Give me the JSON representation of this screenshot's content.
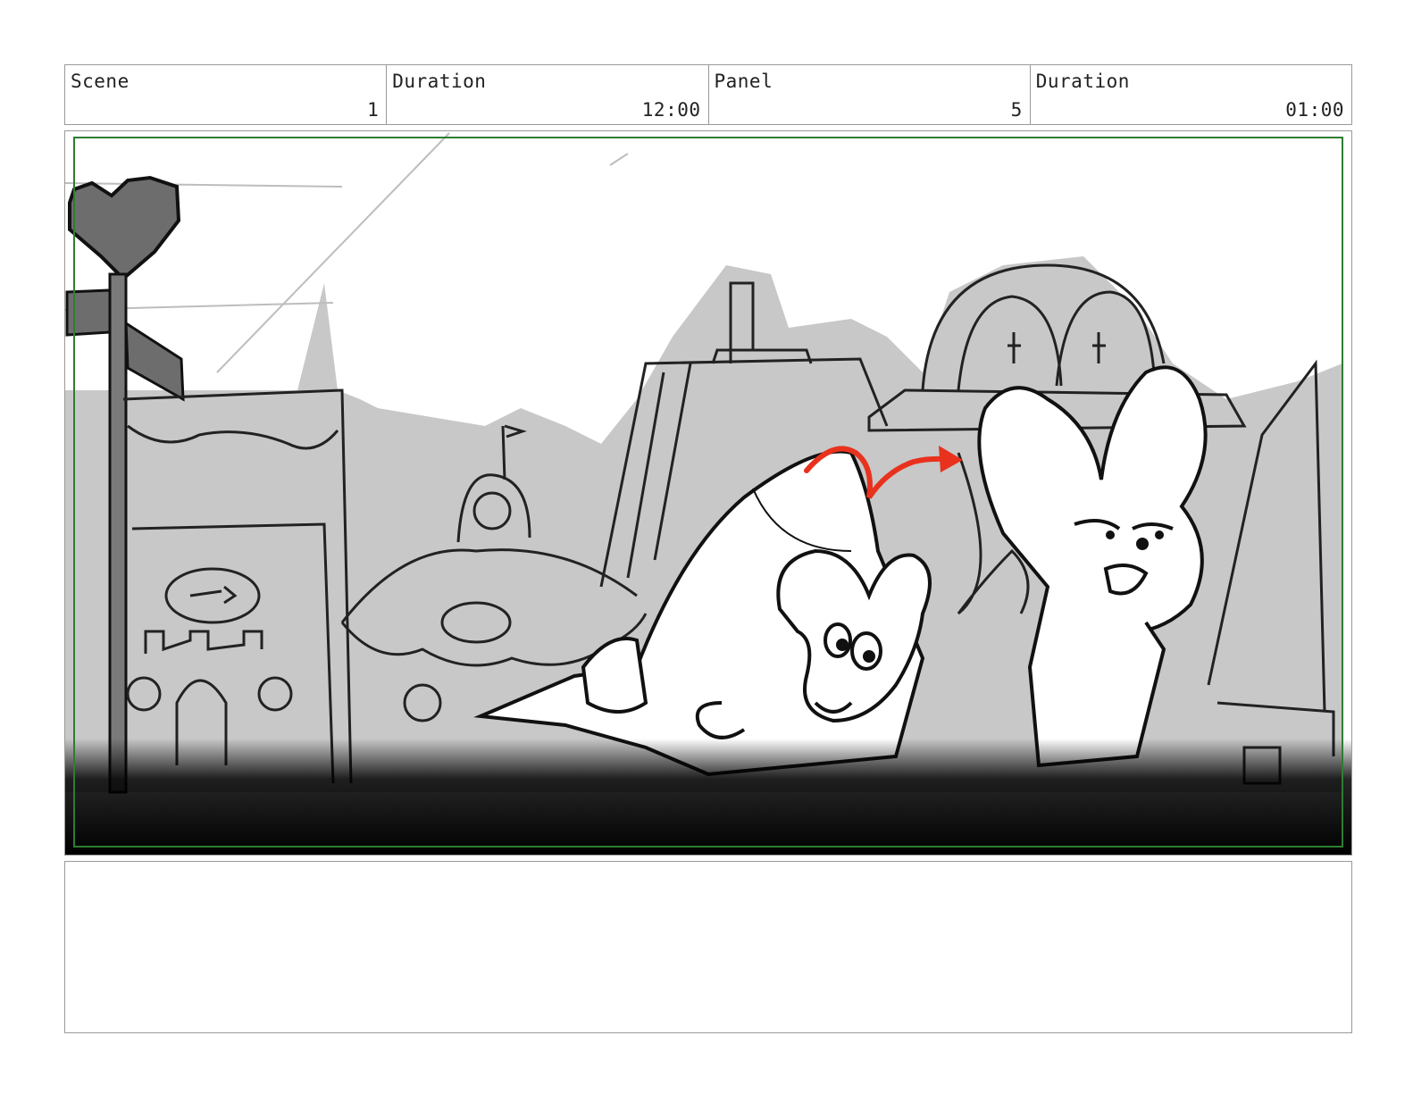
{
  "header": {
    "scene_label": "Scene",
    "scene_value": "1",
    "duration_label": "Duration",
    "duration_value": "12:00",
    "panel_label": "Panel",
    "panel_value": "5",
    "panel_duration_label": "Duration",
    "panel_duration_value": "01:00"
  },
  "panel": {
    "safe_area_color": "#2e7d32",
    "action_arrow_color": "#e8321e",
    "sketch_gray": "#c8c8c8"
  },
  "notes": {
    "text": ""
  }
}
